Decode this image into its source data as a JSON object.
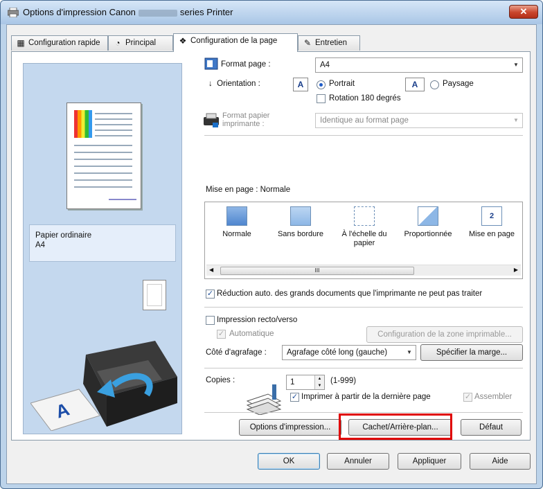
{
  "window": {
    "title_prefix": "Options d'impression Canon",
    "title_suffix": "series Printer",
    "close_label": "✕"
  },
  "tabs": [
    {
      "label": "Configuration rapide",
      "icon": "quick-setup-icon"
    },
    {
      "label": "Principal",
      "icon": "main-icon"
    },
    {
      "label": "Configuration de la page",
      "icon": "page-setup-icon",
      "active": true
    },
    {
      "label": "Entretien",
      "icon": "maintenance-icon"
    }
  ],
  "preview": {
    "media_line1": "Papier ordinaire",
    "media_line2": "A4"
  },
  "page_size": {
    "label": "Format page :",
    "value": "A4"
  },
  "orientation": {
    "label": "Orientation :",
    "portrait": "Portrait",
    "landscape": "Paysage",
    "selected": "Portrait",
    "rotate_label": "Rotation 180 degrés",
    "rotate_checked": false,
    "icon_glyph": "A"
  },
  "printer_paper": {
    "label_line1": "Format papier",
    "label_line2": "imprimante :",
    "value": "Identique au format page"
  },
  "layout": {
    "label": "Mise en page : Normale",
    "items": [
      {
        "label": "Normale",
        "icon": "normal-layout-icon",
        "selected": true
      },
      {
        "label": "Sans bordure",
        "icon": "borderless-icon"
      },
      {
        "label": "À l'échelle du papier",
        "icon": "fit-to-page-icon"
      },
      {
        "label": "Proportionnée",
        "icon": "scaled-icon"
      },
      {
        "label": "Mise en page",
        "icon": "page-layout-icon",
        "glyph": "2"
      }
    ],
    "scroll_grip": "III"
  },
  "auto_reduce": {
    "label": "Réduction auto. des grands documents que l'imprimante ne peut pas traiter",
    "checked": true
  },
  "duplex": {
    "label": "Impression recto/verso",
    "checked": false,
    "auto_label": "Automatique",
    "auto_checked": true,
    "print_area_button": "Configuration de la zone imprimable..."
  },
  "stapling": {
    "label": "Côté d'agrafage :",
    "value": "Agrafage côté long (gauche)",
    "margin_button": "Spécifier la marge..."
  },
  "copies": {
    "label": "Copies :",
    "value": "1",
    "range": "(1-999)",
    "last_page_label": "Imprimer à partir de la dernière page",
    "last_page_checked": true,
    "collate_label": "Assembler",
    "collate_checked": true
  },
  "bottom_buttons": {
    "print_options": "Options d'impression...",
    "stamp_background": "Cachet/Arrière-plan...",
    "defaults": "Défaut"
  },
  "dialog_buttons": {
    "ok": "OK",
    "cancel": "Annuler",
    "apply": "Appliquer",
    "help": "Aide"
  },
  "colors": {
    "highlight": "#e00000",
    "selected_radio": "#1e5cc9"
  }
}
